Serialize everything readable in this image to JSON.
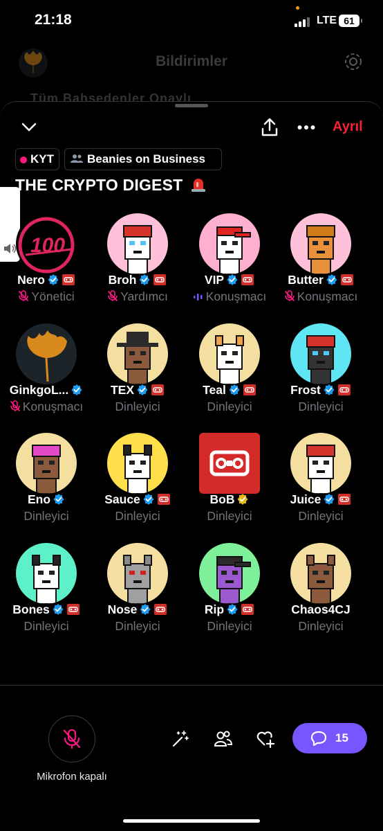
{
  "status_bar": {
    "time": "21:18",
    "network": "LTE",
    "battery": "61"
  },
  "background": {
    "title": "Bildirimler",
    "tabs_partial": "Tüm        Bahsedenler       Onaylı"
  },
  "space": {
    "leave_label": "Ayrıl",
    "chips": {
      "live": "KYT",
      "community": "Beanies on Business"
    },
    "title": "THE CRYPTO DIGEST",
    "title_emoji": "🚨"
  },
  "participants": [
    {
      "name": "Nero",
      "role": "Yönetici",
      "verified": "blue",
      "badge": true,
      "mic": "muted"
    },
    {
      "name": "Broh",
      "role": "Yardımcı",
      "verified": "blue",
      "badge": true,
      "mic": "muted"
    },
    {
      "name": "VIP",
      "role": "Konuşmacı",
      "verified": "blue",
      "badge": true,
      "mic": "speaking"
    },
    {
      "name": "Butter",
      "role": "Konuşmacı",
      "verified": "blue",
      "badge": true,
      "mic": "muted"
    },
    {
      "name": "GinkgoL...",
      "role": "Konuşmacı",
      "verified": "blue",
      "badge": false,
      "mic": "muted"
    },
    {
      "name": "TEX",
      "role": "Dinleyici",
      "verified": "blue",
      "badge": true,
      "mic": "none"
    },
    {
      "name": "Teal",
      "role": "Dinleyici",
      "verified": "blue",
      "badge": true,
      "mic": "none"
    },
    {
      "name": "Frost",
      "role": "Dinleyici",
      "verified": "blue",
      "badge": true,
      "mic": "none"
    },
    {
      "name": "Eno",
      "role": "Dinleyici",
      "verified": "blue",
      "badge": false,
      "mic": "none"
    },
    {
      "name": "Sauce",
      "role": "Dinleyici",
      "verified": "blue",
      "badge": true,
      "mic": "none"
    },
    {
      "name": "BoB",
      "role": "Dinleyici",
      "verified": "gold",
      "badge": false,
      "mic": "none"
    },
    {
      "name": "Juice",
      "role": "Dinleyici",
      "verified": "blue",
      "badge": true,
      "mic": "none"
    },
    {
      "name": "Bones",
      "role": "Dinleyici",
      "verified": "blue",
      "badge": true,
      "mic": "none"
    },
    {
      "name": "Nose",
      "role": "Dinleyici",
      "verified": "blue",
      "badge": true,
      "mic": "none"
    },
    {
      "name": "Rip",
      "role": "Dinleyici",
      "verified": "blue",
      "badge": true,
      "mic": "none"
    },
    {
      "name": "Chaos4CJ",
      "role": "Dinleyici",
      "verified": "none",
      "badge": false,
      "mic": "none"
    }
  ],
  "avatars": {
    "Nero": {
      "bg": "#000000",
      "kind": "hundred",
      "accent": "#e0245e"
    },
    "Broh": {
      "bg": "#ffc0da",
      "kind": "beanie",
      "hat": "#d6332b",
      "face": "#ffffff",
      "eyes": "#4fc3f7"
    },
    "VIP": {
      "bg": "#ffb0d0",
      "kind": "cap",
      "hat": "#e02424",
      "face": "#ffffff",
      "eyes": "#222222"
    },
    "Butter": {
      "bg": "#ffc0da",
      "kind": "beanie",
      "hat": "#d07a1a",
      "face": "#e8913a",
      "eyes": "#222222"
    },
    "GinkgoL...": {
      "bg": "#1c2329",
      "kind": "ginkgo",
      "accent": "#d98a1f"
    },
    "TEX": {
      "bg": "#f5dfa0",
      "kind": "cowboy",
      "hat": "#2b2b2b",
      "face": "#8b5a3c",
      "eyes": "#222222"
    },
    "Teal": {
      "bg": "#f5dfa0",
      "kind": "shiba",
      "hat": "#f0a046",
      "face": "#ffffff",
      "eyes": "#222222"
    },
    "Frost": {
      "bg": "#5ee6f5",
      "kind": "beanie",
      "hat": "#d6332b",
      "face": "#333333",
      "eyes": "#4fc3f7"
    },
    "Eno": {
      "bg": "#f5dfa0",
      "kind": "beanie",
      "hat": "#e24ac8",
      "face": "#8b5a3c",
      "eyes": "#222222"
    },
    "Sauce": {
      "bg": "#ffe04a",
      "kind": "cat",
      "hat": "#222222",
      "face": "#ffffff",
      "eyes": "#222222"
    },
    "BoB": {
      "bg": "#d42a2a",
      "kind": "logo",
      "accent": "#ffffff"
    },
    "Juice": {
      "bg": "#f5dfa0",
      "kind": "beanie",
      "hat": "#d6332b",
      "face": "#ffffff",
      "eyes": "#222222"
    },
    "Bones": {
      "bg": "#5ef0c8",
      "kind": "husky",
      "hat": "#222222",
      "face": "#ffffff",
      "eyes": "#222222"
    },
    "Nose": {
      "bg": "#f5dfa0",
      "kind": "mouse",
      "hat": "#8a8a8a",
      "face": "#a0a0a0",
      "eyes": "#d02020"
    },
    "Rip": {
      "bg": "#7ef09a",
      "kind": "cap",
      "hat": "#2b2b2b",
      "face": "#9b59d0",
      "eyes": "#222222"
    },
    "Chaos4CJ": {
      "bg": "#f5dfa0",
      "kind": "bear",
      "hat": "#8b5a3c",
      "face": "#8b5a3c",
      "eyes": "#222222"
    }
  },
  "footer": {
    "mic_label": "Mikrofon kapalı",
    "comment_count": "15"
  },
  "colors": {
    "accent": "#7856ff",
    "verified_blue": "#1d9bf0",
    "verified_gold": "#e2b719",
    "leave": "#f4212e",
    "badge": "#d0302a",
    "muted": "#71767b",
    "live_dot": "#f91880"
  }
}
